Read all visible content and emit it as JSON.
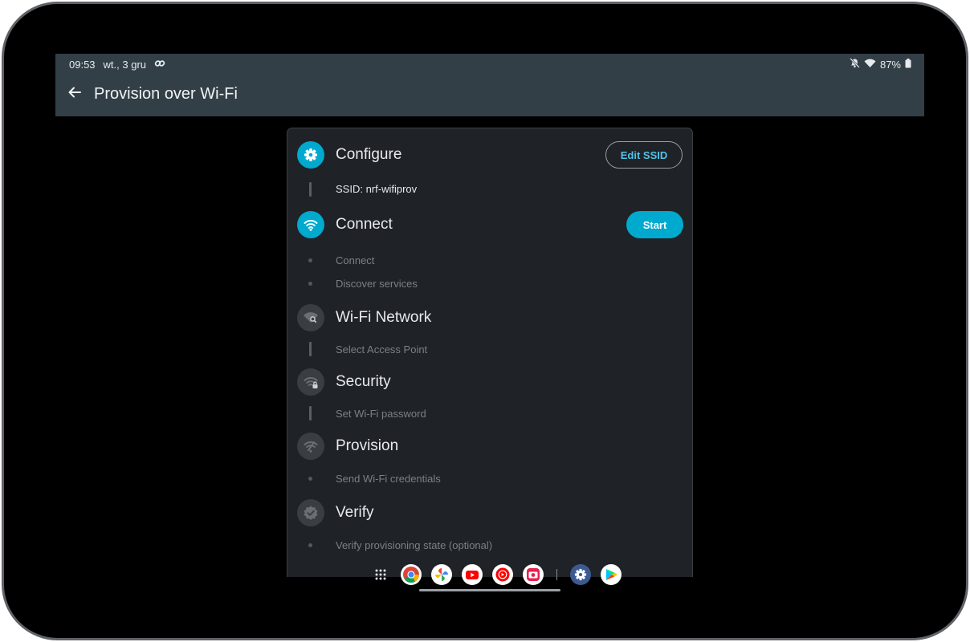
{
  "status_bar": {
    "time": "09:53",
    "date": "wt., 3 gru",
    "battery": "87%"
  },
  "app_bar": {
    "title": "Provision over Wi-Fi"
  },
  "steps": [
    {
      "title": "Configure",
      "icon": "gear-icon",
      "action": "Edit SSID",
      "items": [
        "SSID: nrf-wifiprov"
      ]
    },
    {
      "title": "Connect",
      "icon": "wifi-icon",
      "action": "Start",
      "items": [
        "Connect",
        "Discover services"
      ]
    },
    {
      "title": "Wi-Fi Network",
      "icon": "wifi-search-icon",
      "items": [
        "Select Access Point"
      ]
    },
    {
      "title": "Security",
      "icon": "wifi-lock-icon",
      "items": [
        "Set Wi-Fi password"
      ]
    },
    {
      "title": "Provision",
      "icon": "wifi-provision-icon",
      "items": [
        "Send Wi-Fi credentials"
      ]
    },
    {
      "title": "Verify",
      "icon": "verified-badge-icon",
      "items": [
        "Verify provisioning state (optional)"
      ]
    }
  ],
  "taskbar": {
    "apps": [
      "app-drawer-icon",
      "chrome-icon",
      "photos-icon",
      "youtube-icon",
      "youtube-music-icon",
      "camera-icon",
      "settings-icon",
      "play-store-icon"
    ]
  },
  "colors": {
    "accent": "#00a9ce",
    "app_bar": "#333f47",
    "card": "#1f2226"
  }
}
